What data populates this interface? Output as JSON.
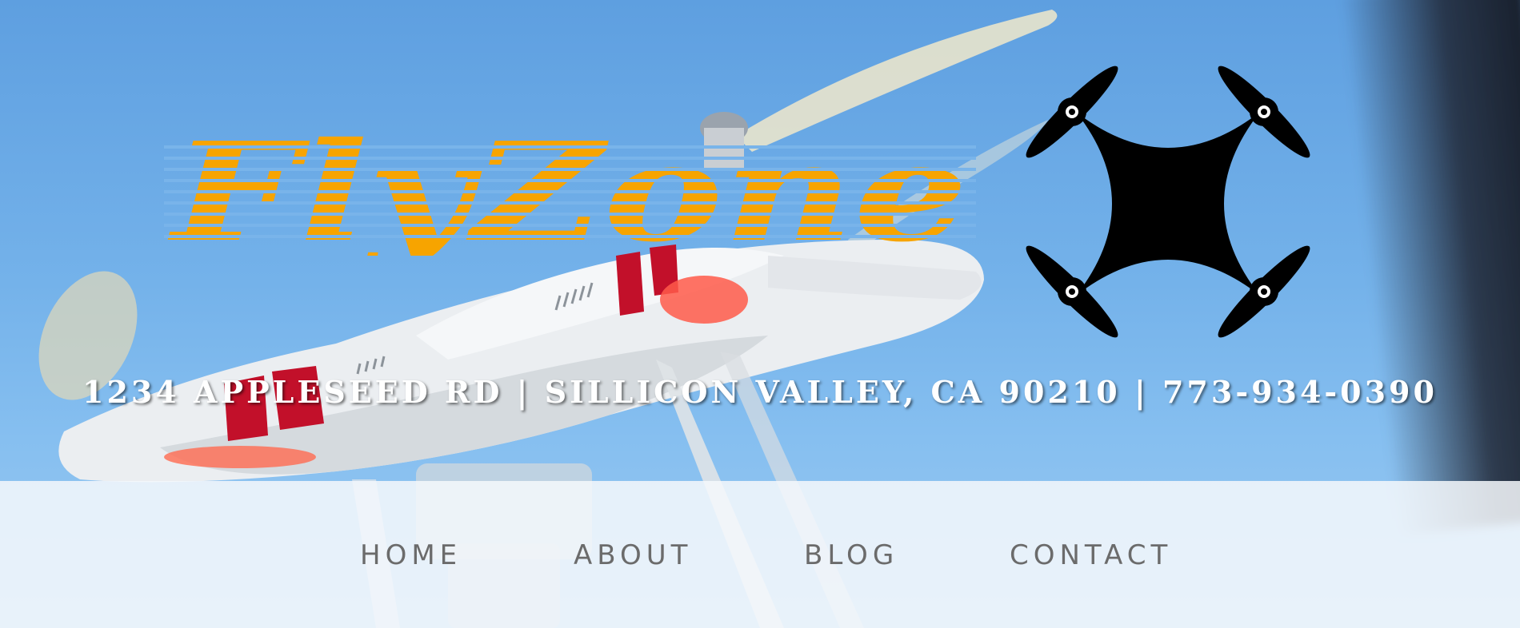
{
  "header": {
    "logo_text": "FlyZone",
    "logo_icon": "quadcopter-drone-icon",
    "address_line": "1234 APPLESEED RD | SILLICON VALLEY, CA 90210 | 773-934-0390"
  },
  "nav": {
    "items": [
      {
        "label": "HOME"
      },
      {
        "label": "ABOUT"
      },
      {
        "label": "BLOG"
      },
      {
        "label": "CONTACT"
      }
    ]
  },
  "colors": {
    "logo": "#f7a400",
    "sky": "#6aa9e4",
    "nav_text": "#6b6b6b",
    "address_text": "#ffffff"
  }
}
